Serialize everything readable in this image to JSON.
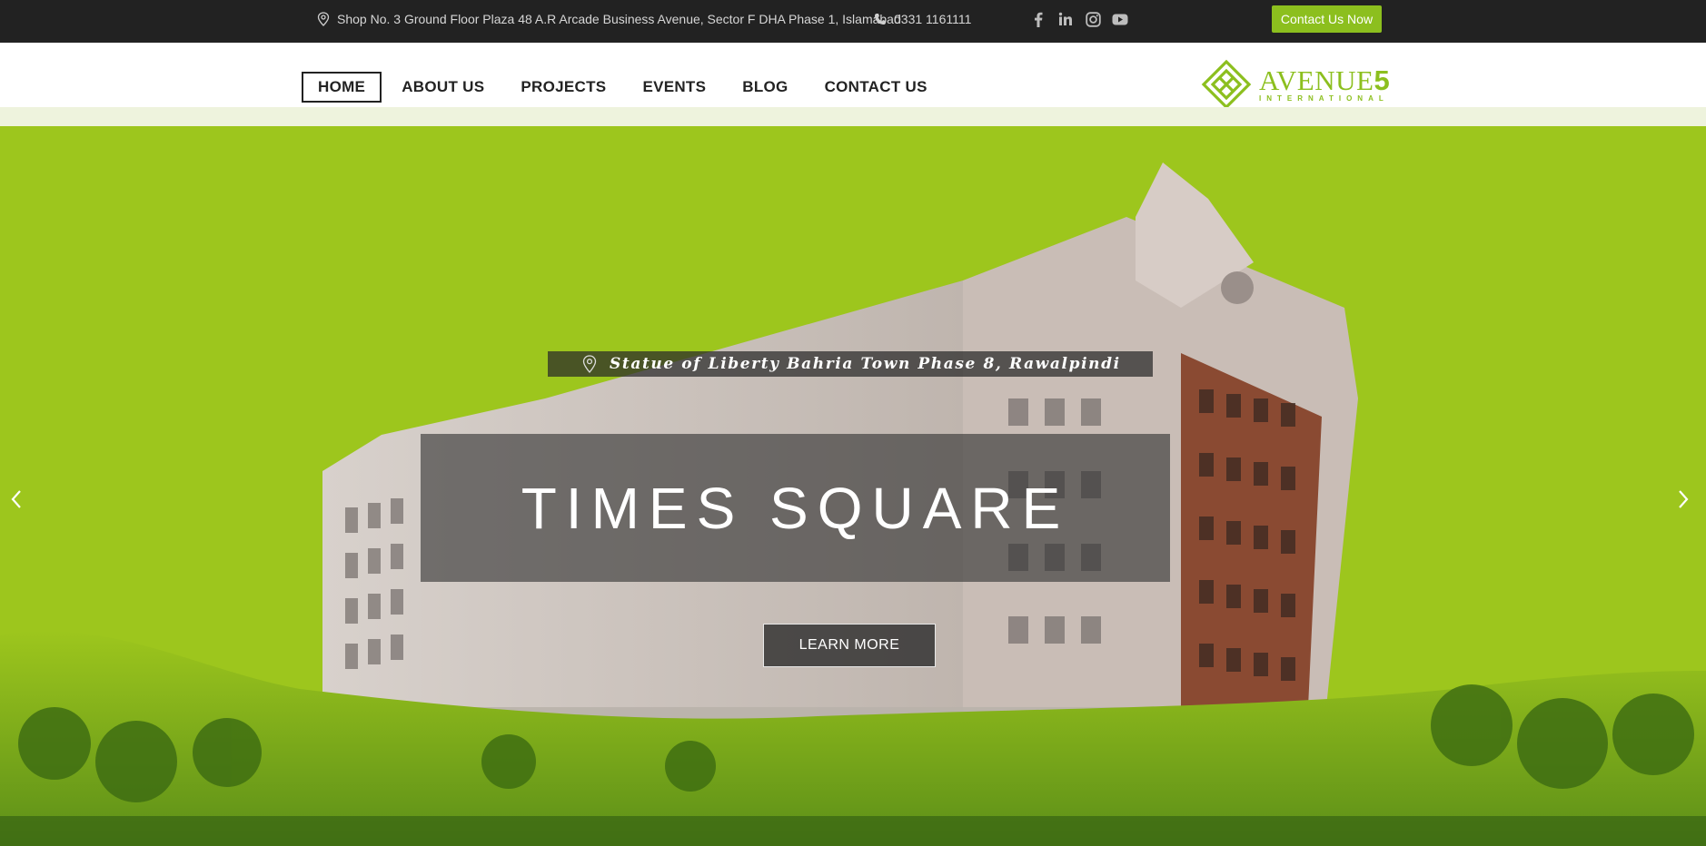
{
  "topbar": {
    "address": "Shop No. 3 Ground Floor Plaza 48 A.R Arcade Business Avenue, Sector F DHA Phase 1, Islamabad",
    "phone": "0331 1161111",
    "socials": [
      "facebook-icon",
      "linkedin-icon",
      "instagram-icon",
      "youtube-icon"
    ],
    "cta_label": "Contact Us Now"
  },
  "nav": {
    "items": [
      {
        "label": "HOME",
        "active": true
      },
      {
        "label": "ABOUT US"
      },
      {
        "label": "PROJECTS"
      },
      {
        "label": "EVENTS"
      },
      {
        "label": "BLOG"
      },
      {
        "label": "CONTACT US"
      }
    ]
  },
  "logo": {
    "name": "AVENUE",
    "numeral": "5",
    "sub": "INTERNATIONAL"
  },
  "hero": {
    "location": "Statue of Liberty Bahria Town Phase 8, Rawalpindi",
    "title": "TIMES SQUARE",
    "button_label": "LEARN MORE",
    "prev_icon": "chevron-left-icon",
    "next_icon": "chevron-right-icon"
  },
  "colors": {
    "accent": "#8cbf1e",
    "hero_bg": "#9dc61d",
    "topbar_bg": "#222222"
  }
}
